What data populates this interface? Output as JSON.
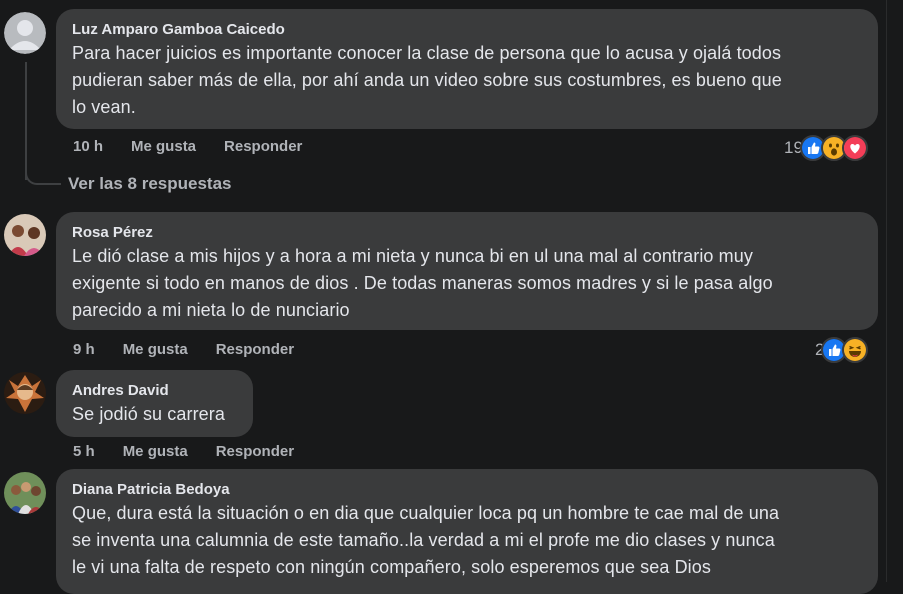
{
  "comments": [
    {
      "author": "Luz Amparo Gamboa Caicedo",
      "lines": [
        "Para hacer juicios es importante conocer la clase de persona que lo acusa y ojalá todos",
        "pudieran saber más de ella, por ahí anda un video sobre sus costumbres, es bueno que",
        "lo vean."
      ],
      "time": "10 h",
      "like_label": "Me gusta",
      "reply_label": "Responder",
      "reaction_count": "19",
      "reactions": [
        "like-icon",
        "wow-icon",
        "love-icon"
      ]
    },
    {
      "author": "Rosa Pérez",
      "lines": [
        "Le dió clase a mis hijos y a hora a mi nieta y nunca bi en ul una mal al contrario muy",
        "exigente si todo en manos de dios . De todas maneras somos madres y si le pasa algo",
        "parecido a mi nieta lo de nunciario"
      ],
      "time": "9 h",
      "like_label": "Me gusta",
      "reply_label": "Responder",
      "reaction_count": "2",
      "reactions": [
        "like-icon",
        "haha-icon"
      ]
    },
    {
      "author": "Andres David",
      "lines": [
        "Se jodió su carrera"
      ],
      "time": "5 h",
      "like_label": "Me gusta",
      "reply_label": "Responder"
    },
    {
      "author": "Diana Patricia Bedoya",
      "lines": [
        "Que, dura está la situación o en dia que cualquier loca pq un hombre te cae mal de una",
        "se inventa una calumnia de este tamaño..la verdad a mi el profe me dio clases y nunca",
        "le vi una falta de respeto con ningún compañero, solo esperemos que sea Dios"
      ]
    }
  ],
  "view_replies": "Ver las 8 respuestas",
  "colors": {
    "background": "#18191a",
    "bubble": "#3a3b3c",
    "text": "#e4e6eb",
    "secondary": "#b0b3b8",
    "like_blue": "#1877f2",
    "love_red": "#f33e58",
    "wow_yellow": "#f7b125"
  }
}
